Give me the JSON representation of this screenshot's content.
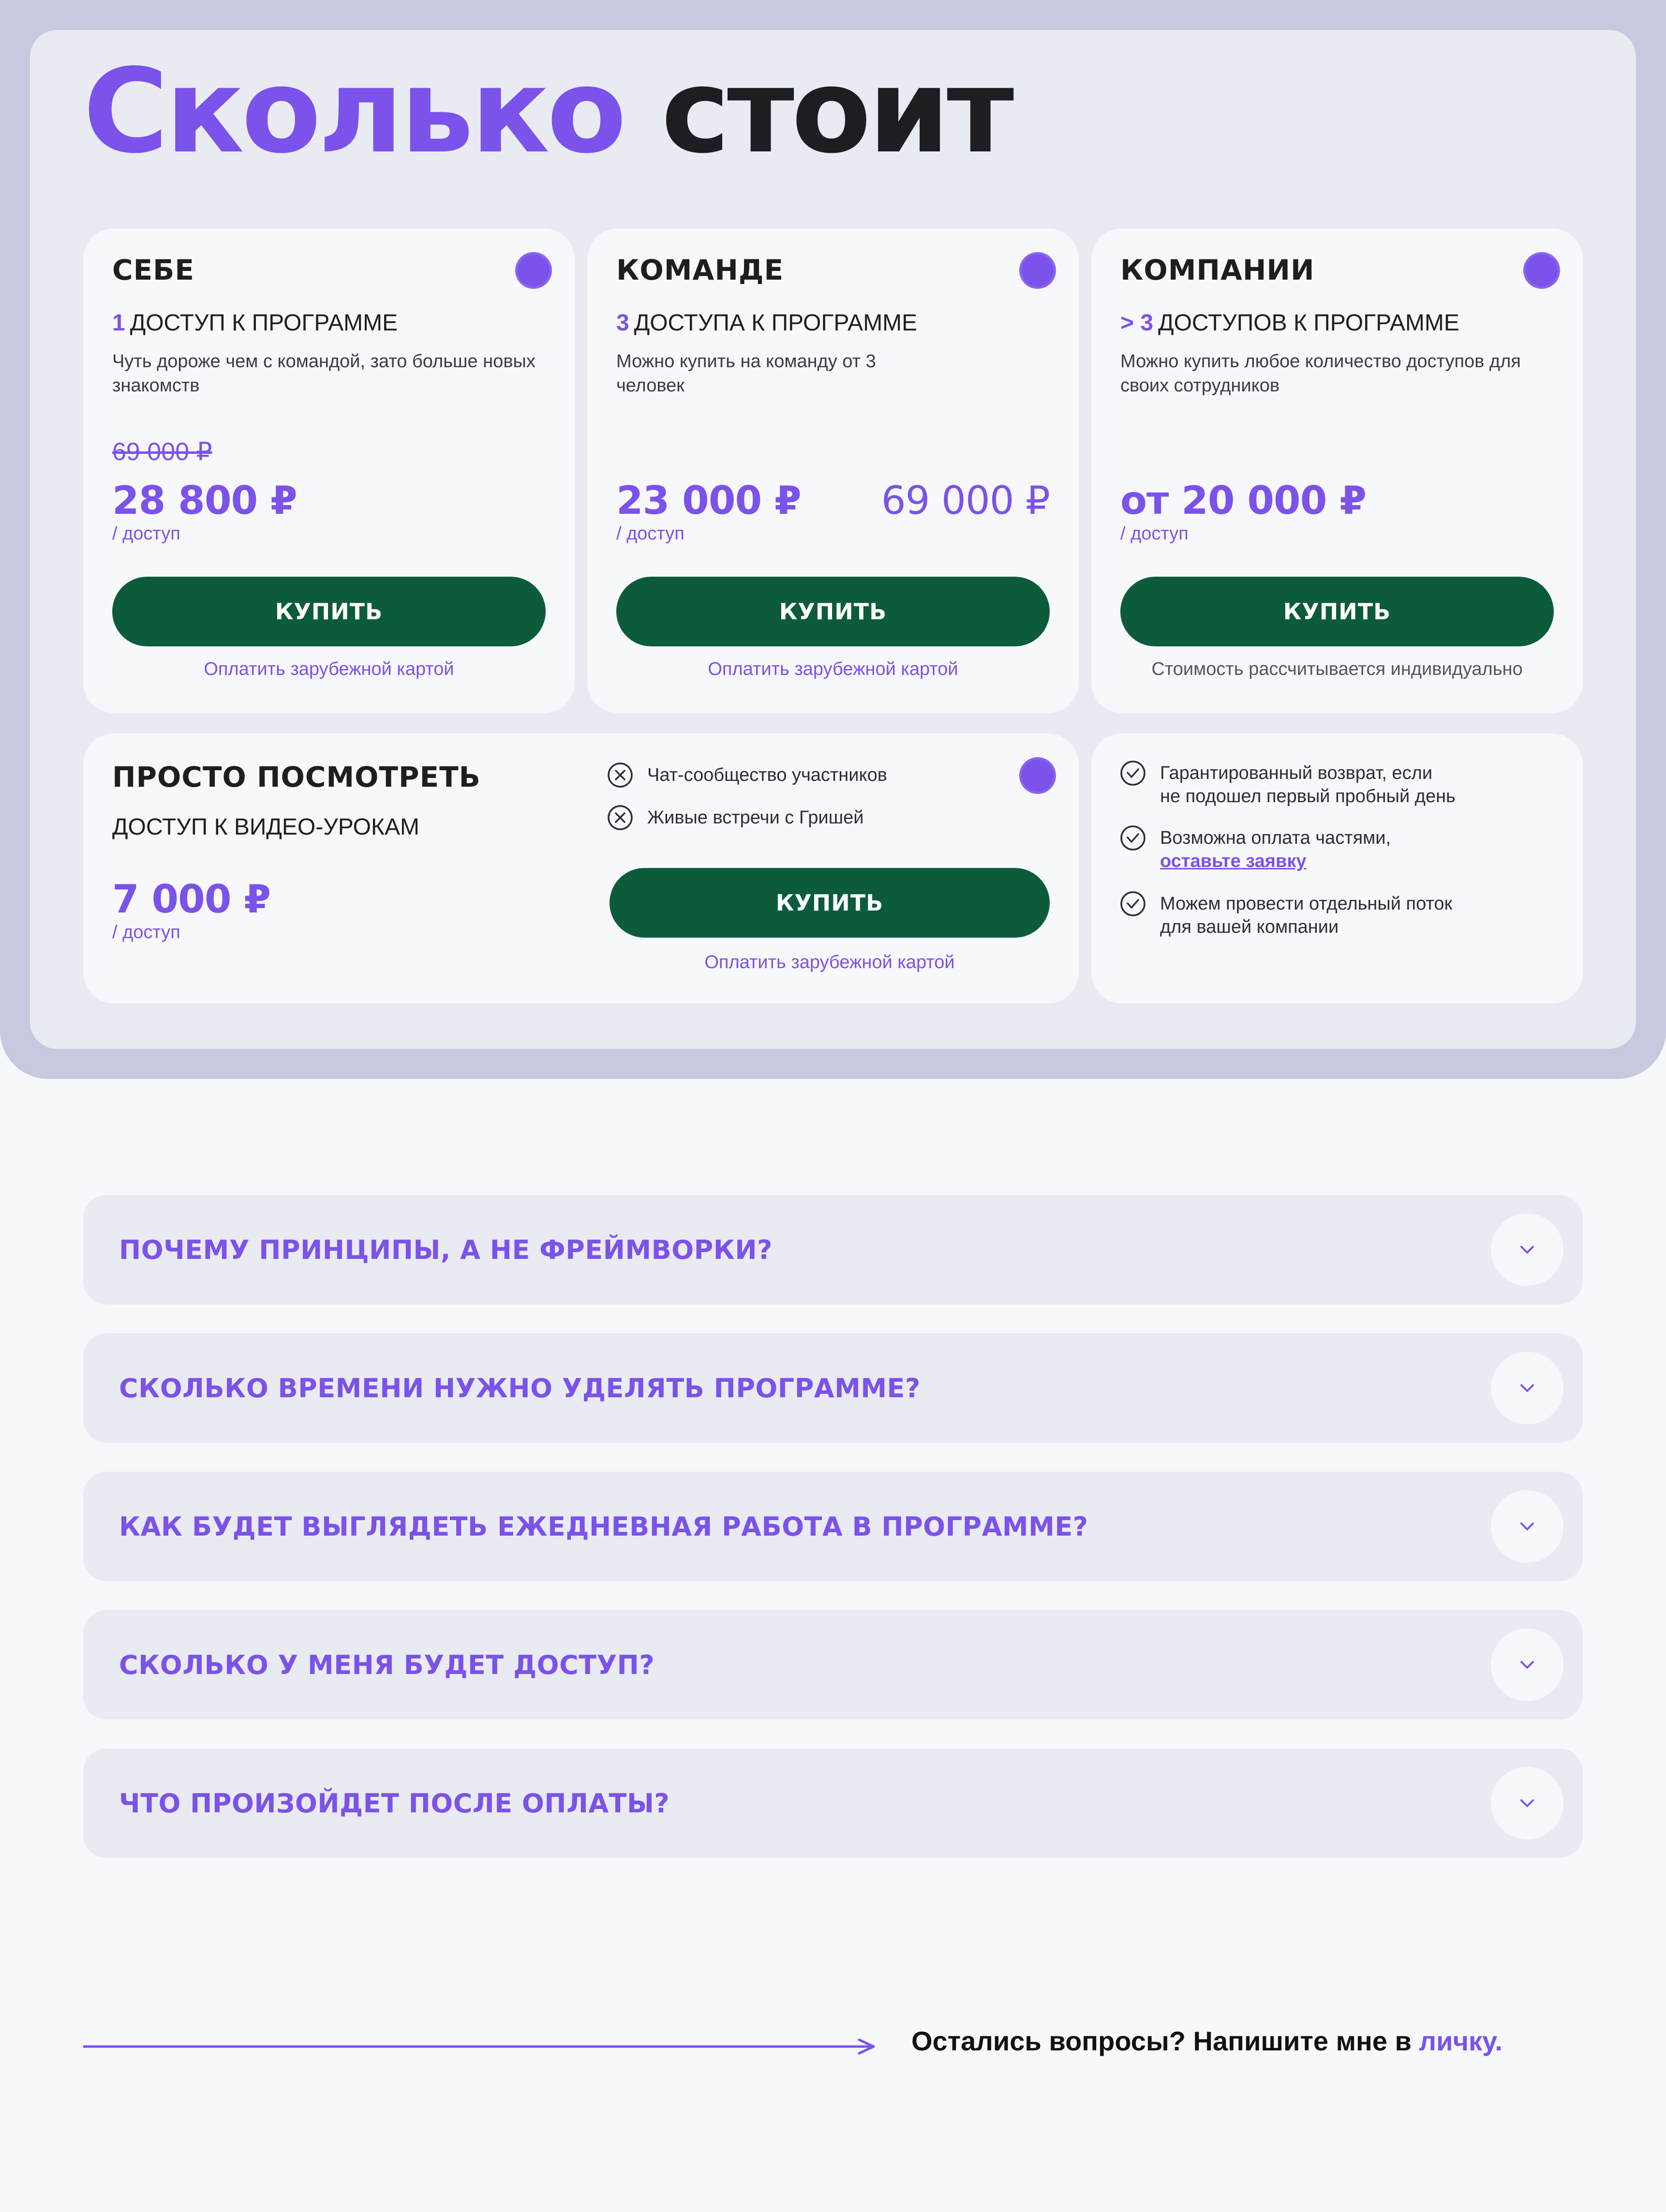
{
  "title": {
    "accent": "Сколько",
    "rest": "стоит"
  },
  "plans": [
    {
      "name": "СЕБЕ",
      "count": "1",
      "access": "ДОСТУП К ПРОГРАММЕ",
      "description": "Чуть дороже чем с командой, зато больше новых знакомств",
      "old_price": "69 000 ₽",
      "price": "28 800 ₽",
      "unit": "/ доступ",
      "button": "КУПИТЬ",
      "note": "Оплатить зарубежной картой"
    },
    {
      "name": "КОМАНДЕ",
      "count": "3",
      "access": "ДОСТУПА К ПРОГРАММЕ",
      "description": "Можно купить на команду от 3 человек",
      "price": "23 000 ₽",
      "price_compare": "69 000 ₽",
      "unit": "/ доступ",
      "button": "КУПИТЬ",
      "note": "Оплатить зарубежной картой"
    },
    {
      "name": "КОМПАНИИ",
      "count": "> 3",
      "access": "ДОСТУПОВ К ПРОГРАММЕ",
      "description": "Можно купить любое количество доступов для своих сотрудников",
      "price": "от 20 000 ₽",
      "unit": "/ доступ",
      "button": "КУПИТЬ",
      "note": "Стоимость рассчитывается индивидуально"
    }
  ],
  "video_plan": {
    "name": "ПРОСТО ПОСМОТРЕТЬ",
    "access": "ДОСТУП К ВИДЕО-УРОКАМ",
    "price": "7 000 ₽",
    "unit": "/ доступ",
    "excluded": [
      "Чат-сообщество участников",
      "Живые встречи с Гришей"
    ],
    "button": "КУПИТЬ",
    "note": "Оплатить зарубежной картой"
  },
  "benefits": [
    {
      "line1": "Гарантированный возврат, если",
      "line2": "не подошел первый пробный день"
    },
    {
      "line1": "Возможна оплата частями,",
      "link": "оставьте заявку"
    },
    {
      "line1": "Можем провести отдельный поток",
      "line2": "для вашей компании"
    }
  ],
  "faq": [
    "ПОЧЕМУ ПРИНЦИПЫ, А НЕ ФРЕЙМВОРКИ?",
    "СКОЛЬКО ВРЕМЕНИ НУЖНО УДЕЛЯТЬ ПРОГРАММЕ?",
    "КАК БУДЕТ ВЫГЛЯДЕТЬ ЕЖЕДНЕВНАЯ РАБОТА В ПРОГРАММЕ?",
    "СКОЛЬКО У МЕНЯ БУДЕТ ДОСТУП?",
    "ЧТО ПРОИЗОЙДЕТ ПОСЛЕ ОПЛАТЫ?"
  ],
  "footer": {
    "text": "Остались вопросы? Напишите мне в",
    "link": "личку."
  },
  "colors": {
    "accent": "#7b52ea",
    "button": "#0c5c3c",
    "frame": "#c6c9df",
    "panel": "#e9ebf3",
    "card": "#f7f8fb"
  },
  "icons": {
    "badge": "purple-seal-icon",
    "excluded": "x-circle-icon",
    "included": "check-circle-icon",
    "faq": "chevron-down-icon",
    "footer": "arrow-right-icon"
  }
}
